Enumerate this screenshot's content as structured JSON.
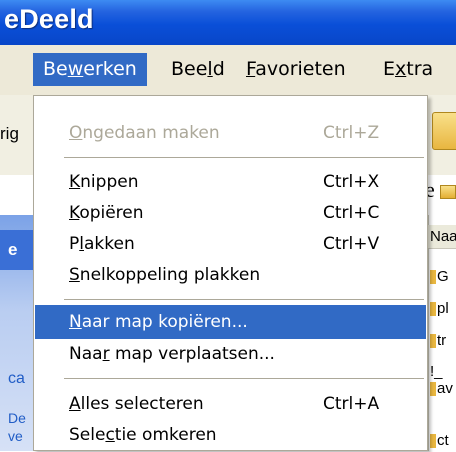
{
  "window": {
    "title": "eDeeld"
  },
  "menubar": {
    "items": [
      {
        "before": "Be",
        "accel": "w",
        "after": "erken"
      },
      {
        "before": "Bee",
        "accel": "l",
        "after": "d"
      },
      {
        "before": "",
        "accel": "F",
        "after": "avorieten"
      },
      {
        "before": "E",
        "accel": "x",
        "after": "tra"
      }
    ]
  },
  "edit_menu": {
    "undo": {
      "before": "",
      "accel": "O",
      "after": "ngedaan maken",
      "shortcut": "Ctrl+Z"
    },
    "cut": {
      "before": "",
      "accel": "K",
      "after": "nippen",
      "shortcut": "Ctrl+X"
    },
    "copy": {
      "before": "",
      "accel": "K",
      "after": "opiëren",
      "shortcut": "Ctrl+C"
    },
    "paste": {
      "before": "P",
      "accel": "l",
      "after": "akken",
      "shortcut": "Ctrl+V"
    },
    "paste_shortcut": {
      "before": "",
      "accel": "S",
      "after": "nelkoppeling plakken"
    },
    "copy_to_folder": {
      "before": "",
      "accel": "N",
      "after": "aar map kopiëren..."
    },
    "move_to_folder": {
      "before": "Naa",
      "accel": "r",
      "after": " map verplaatsen..."
    },
    "select_all": {
      "before": "",
      "accel": "A",
      "after": "lles selecteren",
      "shortcut": "Ctrl+A"
    },
    "invert_selection": {
      "before": "Sele",
      "accel": "c",
      "after": "tie omkeren"
    }
  },
  "background": {
    "toolbar_text": "rig",
    "e_letter_1": "e",
    "e_letter_2": "e",
    "left_pane": {
      "head_text": "e",
      "text_ca": "ca",
      "text_de": "De",
      "text_ve": "ve"
    },
    "list": {
      "header": "Naa",
      "rows": [
        "G",
        "pl",
        "tr",
        "!_",
        "av",
        "ct"
      ]
    }
  }
}
